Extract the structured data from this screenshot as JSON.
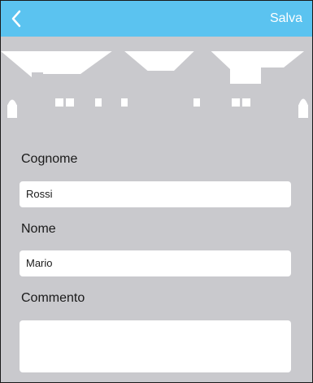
{
  "navbar": {
    "back_icon": "chevron-left-icon",
    "save_label": "Salva",
    "bg_color": "#5bc3f0"
  },
  "form": {
    "surname_label": "Cognome",
    "surname_value": "Rossi",
    "name_label": "Nome",
    "name_value": "Mario",
    "comment_label": "Commento",
    "comment_value": ""
  }
}
